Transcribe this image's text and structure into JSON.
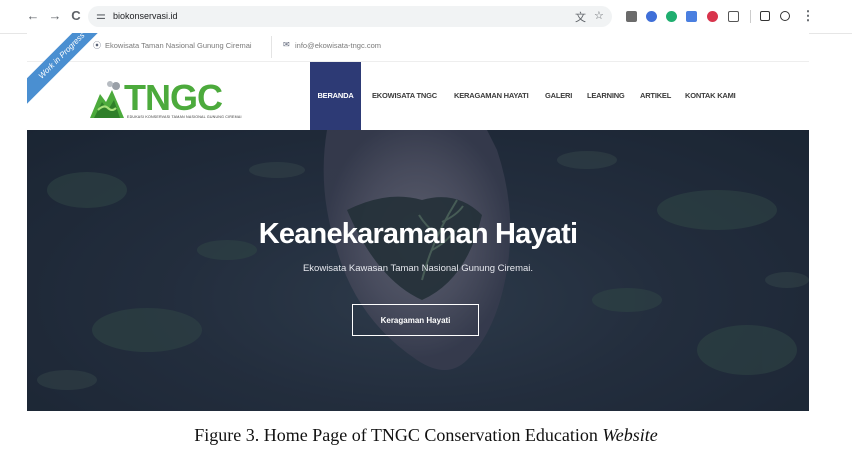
{
  "browser": {
    "url": "biokonservasi.id",
    "back_icon": "←",
    "forward_icon": "→",
    "reload_icon": "C"
  },
  "topbar": {
    "location": "Ekowisata Taman Nasional Gunung Ciremai",
    "email": "info@ekowisata-tngc.com"
  },
  "ribbon": {
    "label": "Work in Progress"
  },
  "logo": {
    "brand": "TNGC",
    "tagline": "EDUKASI KONSERVASI TAMAN NASIONAL GUNUNG CIREMAI"
  },
  "menu": {
    "items": [
      {
        "label": "BERANDA"
      },
      {
        "label": "EKOWISATA TNGC"
      },
      {
        "label": "KERAGAMAN HAYATI"
      },
      {
        "label": "GALERI"
      },
      {
        "label": "LEARNING"
      },
      {
        "label": "ARTIKEL"
      },
      {
        "label": "KONTAK KAMI"
      }
    ]
  },
  "hero": {
    "title": "Keanekaramanan Hayati",
    "subtitle": "Ekowisata Kawasan Taman Nasional Gunung Ciremai.",
    "button_label": "Keragaman Hayati"
  },
  "caption": {
    "text": "Figure 3. Home Page of TNGC Conservation Education ",
    "italic": "Website"
  },
  "colors": {
    "active_menu": "#2d3a75",
    "brand_green": "#4caa3c",
    "ribbon": "#4a8fd1"
  }
}
